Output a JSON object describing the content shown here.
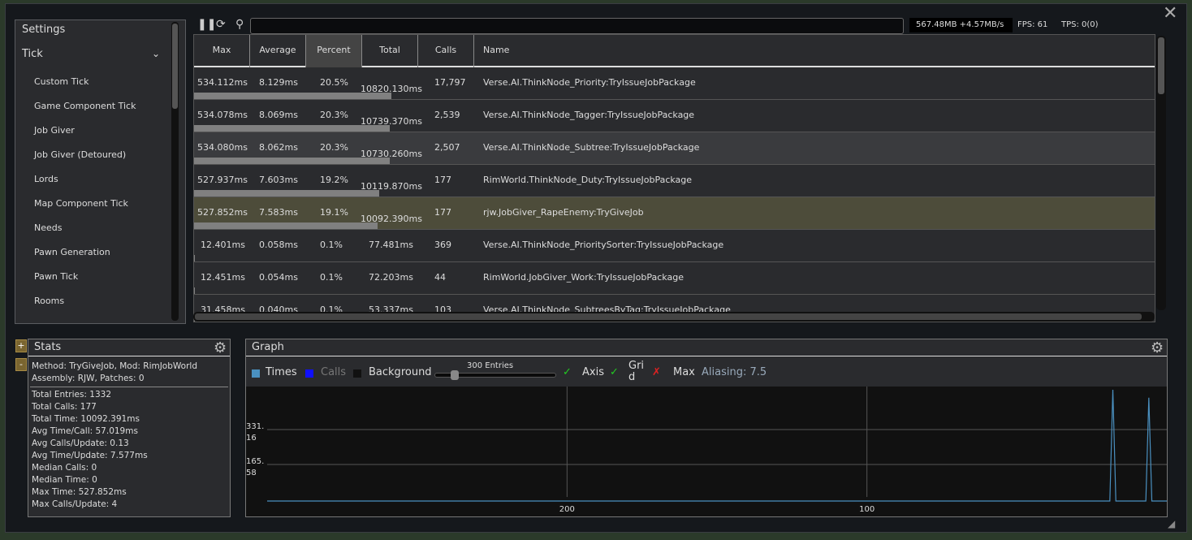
{
  "window": {
    "close_icon": "close-x"
  },
  "settings": {
    "title": "Settings",
    "section": "Tick",
    "items": [
      "Custom Tick",
      "Game Component Tick",
      "Job Giver",
      "Job Giver (Detoured)",
      "Lords",
      "Map Component Tick",
      "Needs",
      "Pawn Generation",
      "Pawn Tick",
      "Rooms"
    ]
  },
  "toolbar": {
    "pause_icon": "pause-icon",
    "refresh_icon": "refresh-icon",
    "search_icon": "search-icon",
    "search_value": "",
    "memory": "567.48MB +4.57MB/s",
    "fps": "FPS: 61",
    "tps": "TPS: 0(0)"
  },
  "table": {
    "columns": [
      "Max",
      "Average",
      "Percent",
      "Total",
      "Calls",
      "Name"
    ],
    "sorted_column": "Percent",
    "rows": [
      {
        "max": "534.112ms",
        "avg": "8.129ms",
        "pct": "20.5%",
        "total": "10820.130ms",
        "calls": "17,797",
        "name": "Verse.AI.ThinkNode_Priority:TryIssueJobPackage",
        "fill": 20.5
      },
      {
        "max": "534.078ms",
        "avg": "8.069ms",
        "pct": "20.3%",
        "total": "10739.370ms",
        "calls": "2,539",
        "name": "Verse.AI.ThinkNode_Tagger:TryIssueJobPackage",
        "fill": 20.3
      },
      {
        "max": "534.080ms",
        "avg": "8.062ms",
        "pct": "20.3%",
        "total": "10730.260ms",
        "calls": "2,507",
        "name": "Verse.AI.ThinkNode_Subtree:TryIssueJobPackage",
        "fill": 20.3,
        "hover": true
      },
      {
        "max": "527.937ms",
        "avg": "7.603ms",
        "pct": "19.2%",
        "total": "10119.870ms",
        "calls": "177",
        "name": "RimWorld.ThinkNode_Duty:TryIssueJobPackage",
        "fill": 19.2
      },
      {
        "max": "527.852ms",
        "avg": "7.583ms",
        "pct": "19.1%",
        "total": "10092.390ms",
        "calls": "177",
        "name": "rjw.JobGiver_RapeEnemy:TryGiveJob",
        "fill": 19.1,
        "selected": true
      },
      {
        "max": "12.401ms",
        "avg": "0.058ms",
        "pct": "0.1%",
        "total": "77.481ms",
        "calls": "369",
        "name": "Verse.AI.ThinkNode_PrioritySorter:TryIssueJobPackage",
        "fill": 0.1
      },
      {
        "max": "12.451ms",
        "avg": "0.054ms",
        "pct": "0.1%",
        "total": "72.203ms",
        "calls": "44",
        "name": "RimWorld.JobGiver_Work:TryIssueJobPackage",
        "fill": 0.1
      },
      {
        "max": "31.458ms",
        "avg": "0.040ms",
        "pct": "0.1%",
        "total": "53.337ms",
        "calls": "103",
        "name": "Verse.AI.ThinkNode_SubtreesByTag:TryIssueJobPackage",
        "fill": 0.1
      }
    ]
  },
  "stats": {
    "title": "Stats",
    "plus": "+",
    "minus": "-",
    "header": [
      "Method: TryGiveJob, Mod: RimJobWorld",
      "Assembly: RJW, Patches: 0"
    ],
    "lines": [
      "Total Entries: 1332",
      "Total Calls: 177",
      "Total Time: 10092.391ms",
      "Avg Time/Call: 57.019ms",
      "Avg Calls/Update: 0.13",
      "Avg Time/Update: 7.577ms",
      "Median Calls: 0",
      "Median Time: 0",
      "Max Time: 527.852ms",
      "Max Calls/Update: 4"
    ]
  },
  "graph": {
    "title": "Graph",
    "times": "Times",
    "calls": "Calls",
    "background": "Background",
    "entries": "300 Entries",
    "entries_value": 300,
    "axis": "Axis",
    "grid": "Gri\nd",
    "max": "Max",
    "aliasing": "Aliasing: 7.5",
    "axis_on": true,
    "grid_on": true,
    "max_on": false,
    "colors": {
      "times": "#4a90c0",
      "calls": "#1010ff",
      "background": "#111111"
    }
  },
  "chart_data": {
    "type": "line",
    "yticks": [
      "331.\n16",
      "165.\n58"
    ],
    "ytick_values": [
      331.16,
      165.58
    ],
    "xticks": [
      "200",
      "100"
    ],
    "xtick_values": [
      200,
      100
    ],
    "ylim": [
      0,
      527.852
    ],
    "xlim": [
      300,
      0
    ],
    "grid": true,
    "series": [
      {
        "name": "Times",
        "color": "#4a90c0",
        "points": [
          [
            300,
            0
          ],
          [
            19,
            0
          ],
          [
            18,
            527.852
          ],
          [
            17,
            0
          ],
          [
            7,
            0
          ],
          [
            6,
            490
          ],
          [
            5,
            0
          ],
          [
            0,
            0
          ]
        ]
      }
    ]
  }
}
